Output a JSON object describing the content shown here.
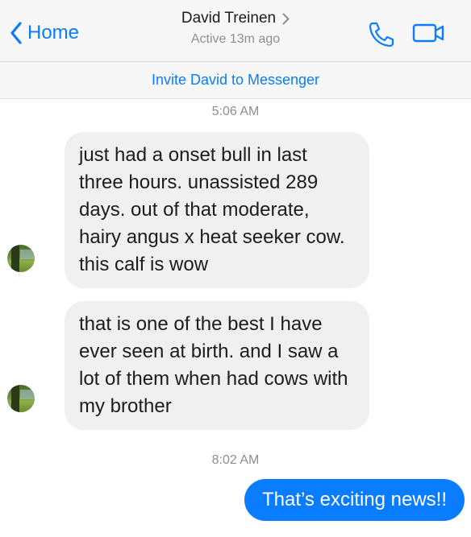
{
  "header": {
    "back_label": "Home",
    "contact_name": "David Treinen",
    "status": "Active 13m ago",
    "accent_color": "#0a7cff",
    "icons": [
      "chevron-left-icon",
      "chevron-right-icon",
      "phone-icon",
      "video-camera-icon"
    ]
  },
  "invite": {
    "label": "Invite David to Messenger"
  },
  "conversation": {
    "timestamp1": "5:06 AM",
    "messages_in": [
      {
        "text": "just had a onset bull in last three hours.  unassisted 289 days.  out of that moderate, hairy angus x heat seeker cow.  this calf is wow"
      },
      {
        "text": "that is one of the best I have ever seen at birth.  and I saw a lot of them when had cows with  my brother"
      }
    ],
    "timestamp2": "8:02 AM",
    "message_out": {
      "text": "That’s exciting news!!"
    }
  }
}
